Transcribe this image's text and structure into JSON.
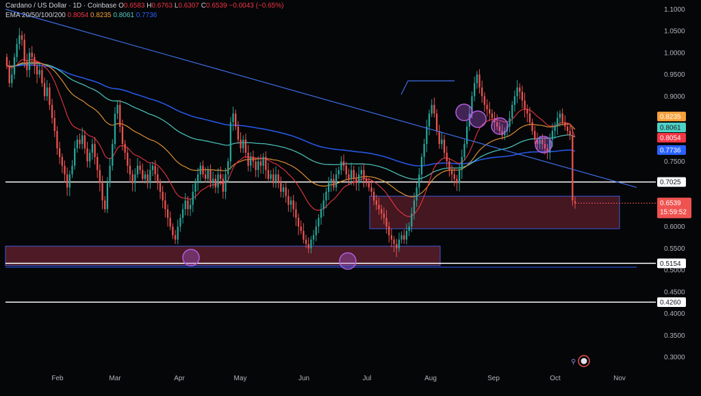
{
  "header": {
    "symbol_line": "Cardano / US Dollar · 1D · Coinbase",
    "ohlc": [
      {
        "label": "O",
        "value": "0.6583"
      },
      {
        "label": "H",
        "value": "0.6763"
      },
      {
        "label": "L",
        "value": "0.6307"
      },
      {
        "label": "C",
        "value": "0.6539"
      }
    ],
    "change": "−0.0043 (−0.65%)",
    "ema_label": "EMA 20/50/100/200",
    "ema_values": [
      "0.8054",
      "0.8235",
      "0.8061",
      "0.7736"
    ]
  },
  "colors": {
    "background": "#050608",
    "up": "#26a69a",
    "down": "#ef5350",
    "ema20": "#f23645",
    "ema50": "#f7a13b",
    "ema100": "#4fd1c5",
    "ema200": "#2962ff",
    "trendline": "#3d6fe8",
    "zone_fill": "#5a1e2a",
    "zone_border": "#3f5bd6",
    "circle": "#b15ee0"
  },
  "chart_data": {
    "type": "candlestick",
    "title": "Cardano / US Dollar · 1D · Coinbase",
    "ylim": [
      0.27,
      1.115
    ],
    "x_ticks": [
      "Feb",
      "Mar",
      "Apr",
      "May",
      "Jun",
      "Jul",
      "Aug",
      "Sep",
      "Oct",
      "Nov"
    ],
    "y_ticks": [
      "1.1000",
      "1.0500",
      "1.0000",
      "0.9500",
      "0.9000",
      "0.7500",
      "0.6000",
      "0.5500",
      "0.5000",
      "0.4500",
      "0.4000",
      "0.3500",
      "0.3000"
    ],
    "last_price": {
      "value": 0.6539,
      "label": "0.6539",
      "countdown": "15:59:52"
    },
    "price_tags": [
      {
        "value": "0.8235",
        "y": 0.8235,
        "color": "#f7a13b"
      },
      {
        "value": "0.8061",
        "y": 0.8061,
        "color": "#4fd1c5"
      },
      {
        "value": "0.8054",
        "y": 0.8054,
        "color": "#f23645"
      },
      {
        "value": "0.7736",
        "y": 0.7736,
        "color": "#2962ff"
      }
    ],
    "horizontal_levels": [
      {
        "value": 0.7025,
        "label": "0.7025"
      },
      {
        "value": 0.5154,
        "label": "0.5154"
      },
      {
        "value": 0.426,
        "label": "0.4260"
      }
    ],
    "candles_close": [
      0.97,
      0.93,
      0.95,
      0.99,
      1.02,
      1.04,
      1.03,
      0.98,
      0.96,
      1.0,
      0.99,
      0.97,
      0.95,
      0.96,
      0.93,
      0.9,
      0.92,
      0.88,
      0.85,
      0.82,
      0.78,
      0.76,
      0.74,
      0.72,
      0.69,
      0.72,
      0.74,
      0.78,
      0.8,
      0.79,
      0.81,
      0.78,
      0.75,
      0.77,
      0.79,
      0.76,
      0.73,
      0.7,
      0.66,
      0.64,
      0.7,
      0.74,
      0.79,
      0.86,
      0.88,
      0.83,
      0.79,
      0.77,
      0.74,
      0.72,
      0.7,
      0.72,
      0.74,
      0.73,
      0.71,
      0.72,
      0.7,
      0.73,
      0.74,
      0.72,
      0.7,
      0.68,
      0.66,
      0.64,
      0.62,
      0.6,
      0.58,
      0.57,
      0.6,
      0.62,
      0.64,
      0.66,
      0.64,
      0.65,
      0.68,
      0.7,
      0.72,
      0.74,
      0.72,
      0.71,
      0.73,
      0.7,
      0.71,
      0.69,
      0.72,
      0.71,
      0.68,
      0.72,
      0.75,
      0.84,
      0.86,
      0.83,
      0.8,
      0.78,
      0.8,
      0.77,
      0.74,
      0.76,
      0.75,
      0.73,
      0.75,
      0.74,
      0.76,
      0.73,
      0.71,
      0.72,
      0.7,
      0.72,
      0.7,
      0.68,
      0.69,
      0.67,
      0.65,
      0.66,
      0.64,
      0.62,
      0.6,
      0.59,
      0.57,
      0.56,
      0.55,
      0.57,
      0.58,
      0.6,
      0.62,
      0.64,
      0.66,
      0.68,
      0.7,
      0.71,
      0.69,
      0.72,
      0.73,
      0.75,
      0.74,
      0.72,
      0.71,
      0.73,
      0.71,
      0.7,
      0.72,
      0.73,
      0.71,
      0.7,
      0.69,
      0.68,
      0.66,
      0.65,
      0.64,
      0.63,
      0.62,
      0.6,
      0.58,
      0.57,
      0.56,
      0.55,
      0.57,
      0.58,
      0.57,
      0.59,
      0.6,
      0.63,
      0.66,
      0.69,
      0.72,
      0.76,
      0.79,
      0.83,
      0.86,
      0.88,
      0.86,
      0.82,
      0.79,
      0.8,
      0.77,
      0.75,
      0.73,
      0.72,
      0.71,
      0.7,
      0.73,
      0.76,
      0.79,
      0.83,
      0.86,
      0.9,
      0.93,
      0.95,
      0.92,
      0.9,
      0.88,
      0.87,
      0.86,
      0.85,
      0.84,
      0.83,
      0.82,
      0.81,
      0.82,
      0.83,
      0.85,
      0.88,
      0.9,
      0.92,
      0.91,
      0.89,
      0.87,
      0.86,
      0.84,
      0.82,
      0.8,
      0.79,
      0.8,
      0.79,
      0.78,
      0.77,
      0.8,
      0.82,
      0.83,
      0.85,
      0.86,
      0.84,
      0.83,
      0.82,
      0.81,
      0.66,
      0.6539
    ],
    "emas": [
      {
        "name": "EMA 20",
        "last": 0.8054
      },
      {
        "name": "EMA 50",
        "last": 0.8235
      },
      {
        "name": "EMA 100",
        "last": 0.8061
      },
      {
        "name": "EMA 200",
        "last": 0.7736
      }
    ],
    "annotations": {
      "trendline": {
        "from": {
          "x": "Jan",
          "y": 1.1
        },
        "to": {
          "x": "Nov",
          "y": 0.69
        }
      },
      "zones": [
        {
          "y_top": 0.67,
          "y_bottom": 0.595,
          "x_from": "Jul",
          "x_to": "Oct"
        },
        {
          "y_top": 0.555,
          "y_bottom": 0.51,
          "x_from": "Jan",
          "x_to": "Aug"
        }
      ]
    }
  }
}
